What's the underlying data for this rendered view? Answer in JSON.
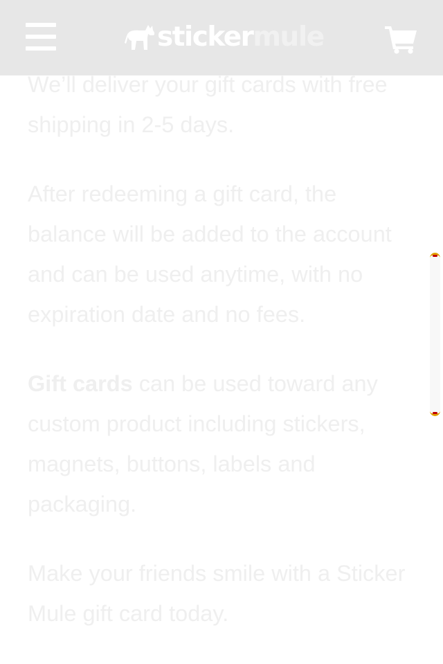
{
  "header": {
    "menu_icon": "hamburger-menu-icon",
    "logo": {
      "part1": "sticker",
      "part2": "mule",
      "icon": "mule-icon"
    },
    "cart_icon": "shopping-cart-icon"
  },
  "content": {
    "paragraph1": "We’ll deliver your gift cards with free shipping in 2-5 days.",
    "paragraph2": "After redeeming a gift card, the balance will be added to the account and can be used anytime, with no expiration date and no fees.",
    "paragraph3": {
      "link": "Gift cards",
      "text": " can be used toward any custom product including stickers, magnets, buttons, labels and packaging."
    },
    "paragraph4": "Make your friends smile with a Sticker Mule gift card today."
  },
  "colors": {
    "header_bg": "#e7e7e7",
    "text": "#efefef",
    "scrollbar_accent": "#e0a000"
  }
}
